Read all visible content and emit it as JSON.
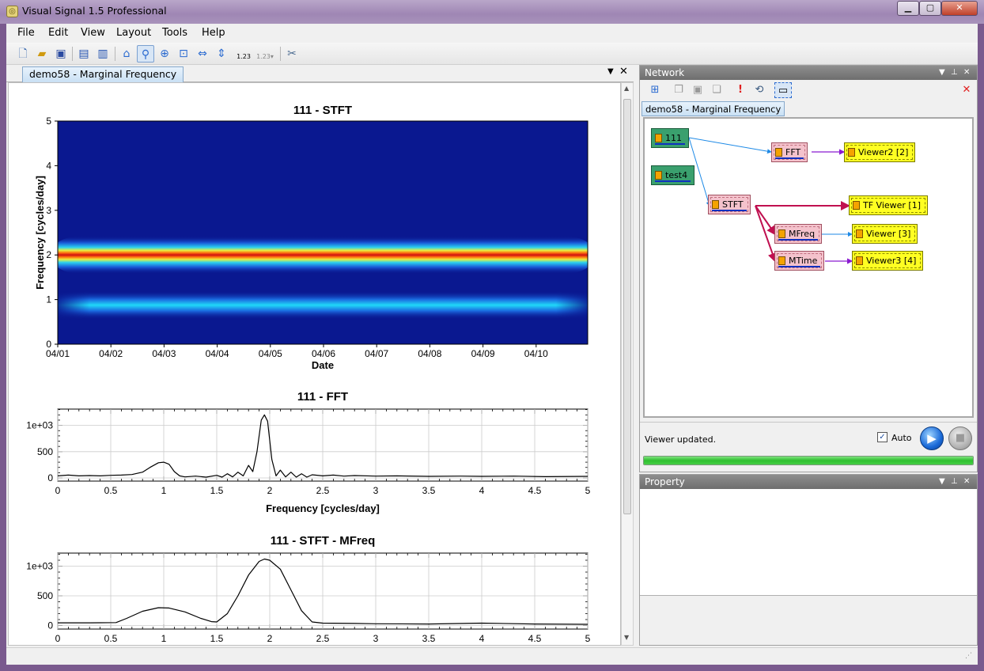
{
  "window": {
    "title": "Visual Signal 1.5 Professional"
  },
  "menu": [
    "File",
    "Edit",
    "View",
    "Layout",
    "Tools",
    "Help"
  ],
  "toolbar": {
    "icons": [
      "new-file-icon",
      "open-folder-icon",
      "save-icon",
      "export-icon",
      "export-all-icon",
      "home-icon",
      "zoom-rect-icon",
      "zoom-in-icon",
      "zoom-fit-icon",
      "zoom-x-icon",
      "zoom-y-icon",
      "axis-scale-icon",
      "axis-scale-dropdown-icon",
      "tools-icon"
    ],
    "axis_scale_label": "1.23"
  },
  "document": {
    "tab_label": "demo58 - Marginal Frequency"
  },
  "charts": [
    {
      "type": "heatmap",
      "title": "111 - STFT",
      "xlabel": "Date",
      "ylabel": "Frequency [cycles/day]",
      "x_ticks": [
        "04/01",
        "04/02",
        "04/03",
        "04/04",
        "04/05",
        "04/06",
        "04/07",
        "04/08",
        "04/09",
        "04/10"
      ],
      "y_ticks": [
        "0",
        "1",
        "2",
        "3",
        "4",
        "5"
      ],
      "ylim": [
        0,
        5
      ],
      "bands": [
        {
          "frequency": 2.0,
          "intensity": "high"
        },
        {
          "frequency": 1.0,
          "intensity": "medium"
        }
      ],
      "colormap": "jet"
    },
    {
      "type": "line",
      "title": "111 - FFT",
      "xlabel": "Frequency [cycles/day]",
      "ylabel": "",
      "x_ticks": [
        "0",
        "0.5",
        "1",
        "1.5",
        "2",
        "2.5",
        "3",
        "3.5",
        "4",
        "4.5",
        "5"
      ],
      "y_ticks": [
        "0",
        "500",
        "1e+03"
      ],
      "xlim": [
        0,
        5
      ],
      "ylim": [
        -60,
        1310
      ],
      "points": [
        [
          0,
          40
        ],
        [
          0.1,
          55
        ],
        [
          0.2,
          40
        ],
        [
          0.3,
          45
        ],
        [
          0.4,
          40
        ],
        [
          0.5,
          50
        ],
        [
          0.6,
          55
        ],
        [
          0.7,
          65
        ],
        [
          0.8,
          110
        ],
        [
          0.87,
          200
        ],
        [
          0.95,
          290
        ],
        [
          1.0,
          300
        ],
        [
          1.05,
          260
        ],
        [
          1.1,
          120
        ],
        [
          1.15,
          40
        ],
        [
          1.2,
          20
        ],
        [
          1.3,
          35
        ],
        [
          1.4,
          15
        ],
        [
          1.5,
          50
        ],
        [
          1.55,
          15
        ],
        [
          1.6,
          80
        ],
        [
          1.65,
          20
        ],
        [
          1.7,
          110
        ],
        [
          1.75,
          40
        ],
        [
          1.8,
          240
        ],
        [
          1.84,
          120
        ],
        [
          1.88,
          500
        ],
        [
          1.92,
          1100
        ],
        [
          1.95,
          1200
        ],
        [
          1.98,
          1080
        ],
        [
          2.02,
          350
        ],
        [
          2.06,
          40
        ],
        [
          2.1,
          150
        ],
        [
          2.15,
          20
        ],
        [
          2.2,
          110
        ],
        [
          2.25,
          15
        ],
        [
          2.3,
          80
        ],
        [
          2.35,
          15
        ],
        [
          2.4,
          60
        ],
        [
          2.5,
          40
        ],
        [
          2.6,
          55
        ],
        [
          2.7,
          35
        ],
        [
          2.8,
          45
        ],
        [
          3.0,
          35
        ],
        [
          3.2,
          40
        ],
        [
          3.5,
          30
        ],
        [
          3.8,
          35
        ],
        [
          4.0,
          30
        ],
        [
          4.3,
          35
        ],
        [
          4.6,
          25
        ],
        [
          5.0,
          30
        ]
      ]
    },
    {
      "type": "line",
      "title": "111 - STFT - MFreq",
      "xlabel": "",
      "ylabel": "",
      "x_ticks": [
        "0",
        "0.5",
        "1",
        "1.5",
        "2",
        "2.5",
        "3",
        "3.5",
        "4",
        "4.5",
        "5"
      ],
      "y_ticks": [
        "0",
        "500",
        "1e+03"
      ],
      "xlim": [
        0,
        5
      ],
      "ylim": [
        -60,
        1220
      ],
      "points": [
        [
          0,
          45
        ],
        [
          0.3,
          45
        ],
        [
          0.55,
          50
        ],
        [
          0.65,
          120
        ],
        [
          0.8,
          240
        ],
        [
          0.95,
          300
        ],
        [
          1.05,
          295
        ],
        [
          1.2,
          230
        ],
        [
          1.35,
          120
        ],
        [
          1.45,
          65
        ],
        [
          1.5,
          60
        ],
        [
          1.6,
          200
        ],
        [
          1.7,
          500
        ],
        [
          1.8,
          850
        ],
        [
          1.9,
          1080
        ],
        [
          1.95,
          1120
        ],
        [
          2.0,
          1100
        ],
        [
          2.1,
          950
        ],
        [
          2.2,
          600
        ],
        [
          2.3,
          250
        ],
        [
          2.4,
          60
        ],
        [
          2.5,
          40
        ],
        [
          2.8,
          35
        ],
        [
          3.0,
          30
        ],
        [
          3.5,
          25
        ],
        [
          4.0,
          40
        ],
        [
          4.5,
          25
        ],
        [
          5.0,
          20
        ]
      ]
    }
  ],
  "network": {
    "panel_title": "Network",
    "tab_label": "demo58 - Marginal Frequency",
    "nodes": {
      "n111": "111",
      "test4": "test4",
      "fft": "FFT",
      "viewer2": "Viewer2 [2]",
      "stft": "STFT",
      "tfviewer": "TF Viewer [1]",
      "mfreq": "MFreq",
      "viewer": "Viewer [3]",
      "mtime": "MTime",
      "viewer3": "Viewer3 [4]"
    },
    "status_text": "Viewer updated.",
    "auto_label": "Auto",
    "auto_checked": true,
    "progress": 1.0,
    "colors": {
      "source": "#3aa06e",
      "process": "#f4c2cc",
      "viewer": "#ffff22",
      "link_blue": "#1e8ae6",
      "link_red": "#c01050",
      "link_purple": "#8a1ad0"
    }
  },
  "property": {
    "panel_title": "Property"
  }
}
